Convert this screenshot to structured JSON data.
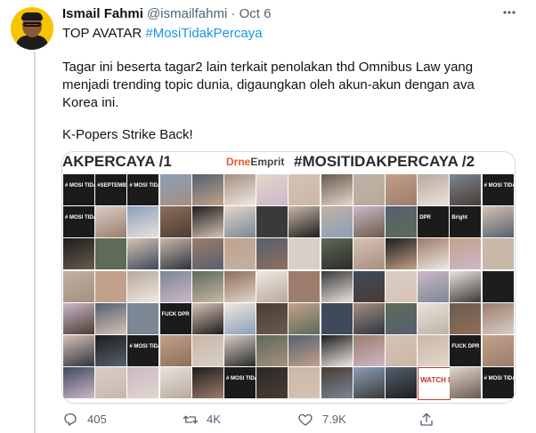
{
  "tweet": {
    "author_name": "Ismail Fahmi",
    "handle": "@ismailfahmi",
    "separator": "·",
    "date": "Oct 6",
    "line1_prefix": "TOP AVATAR ",
    "line1_hashtag": "#MosiTidakPercaya",
    "paragraph1": "Tagar ini beserta tagar2 lain terkait penolakan thd Omnibus Law yang menjadi trending topic dunia, digaungkan oleh akun-akun dengan ava Korea ini.",
    "paragraph2": "K-Popers Strike Back!"
  },
  "media": {
    "banner_left": "AKPERCAYA /1",
    "logo_drone": "Dr",
    "logo_mid": "ne",
    "logo_end": "Emprit",
    "banner_right": "#MOSITIDAKPERCAYA /2",
    "tile_labels": [
      "# MOSI TIDAK PERCAYA",
      "#SEPTEMBER",
      "FUCK DPR",
      "Bright",
      "DPR",
      "WATCH DOC",
      "FUCK DPR"
    ]
  },
  "actions": {
    "reply_count": "405",
    "retweet_count": "4K",
    "like_count": "7.9K",
    "reply_icon": "reply-icon",
    "retweet_icon": "retweet-icon",
    "like_icon": "heart-icon",
    "share_icon": "share-icon"
  },
  "colors": {
    "hashtag": "#1b95e0",
    "muted": "#536471",
    "border": "#cfd9de"
  }
}
